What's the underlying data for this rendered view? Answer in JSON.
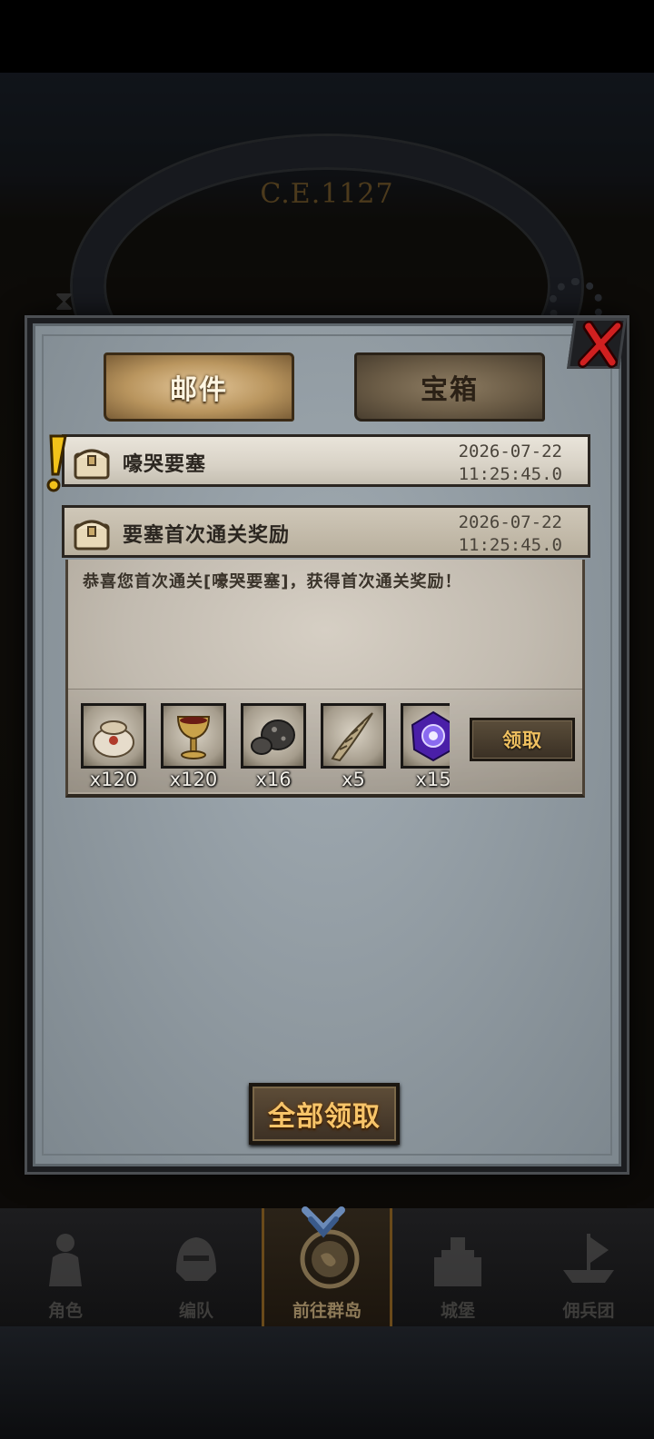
{
  "background": {
    "era_label": "C.E.1127"
  },
  "tabs": [
    {
      "label": "邮件",
      "active": true
    },
    {
      "label": "宝箱",
      "active": false
    }
  ],
  "mails": [
    {
      "subject": "嚎哭要塞",
      "date": "2026-07-22",
      "time": "11:25:45.0",
      "has_alert": true
    },
    {
      "subject": "要塞首次通关奖励",
      "date": "2026-07-22",
      "time": "11:25:45.0",
      "expanded": true
    }
  ],
  "opened_mail": {
    "message": "恭喜您首次通关[嚎哭要塞]，获得首次通关奖励！",
    "rewards": [
      {
        "icon": "grain-sack-icon",
        "count": "x120"
      },
      {
        "icon": "golden-chalice-icon",
        "count": "x120"
      },
      {
        "icon": "ore-stone-icon",
        "count": "x16"
      },
      {
        "icon": "horn-icon",
        "count": "x5"
      },
      {
        "icon": "purple-crystal-icon",
        "count": "x15"
      }
    ],
    "claim_label": "领取"
  },
  "claim_all_label": "全部领取",
  "bottom_nav": [
    {
      "label": "角色",
      "icon": "knight-icon"
    },
    {
      "label": "编队",
      "icon": "helmet-icon"
    },
    {
      "label": "前往群岛",
      "icon": "compass-map-icon",
      "active": true
    },
    {
      "label": "城堡",
      "icon": "castle-icon"
    },
    {
      "label": "佣兵团",
      "icon": "ship-icon"
    }
  ],
  "colors": {
    "panel": "#8e989f",
    "tab_active": "#b9955e",
    "button_text": "#f7c469",
    "close_x": "#d02020"
  }
}
